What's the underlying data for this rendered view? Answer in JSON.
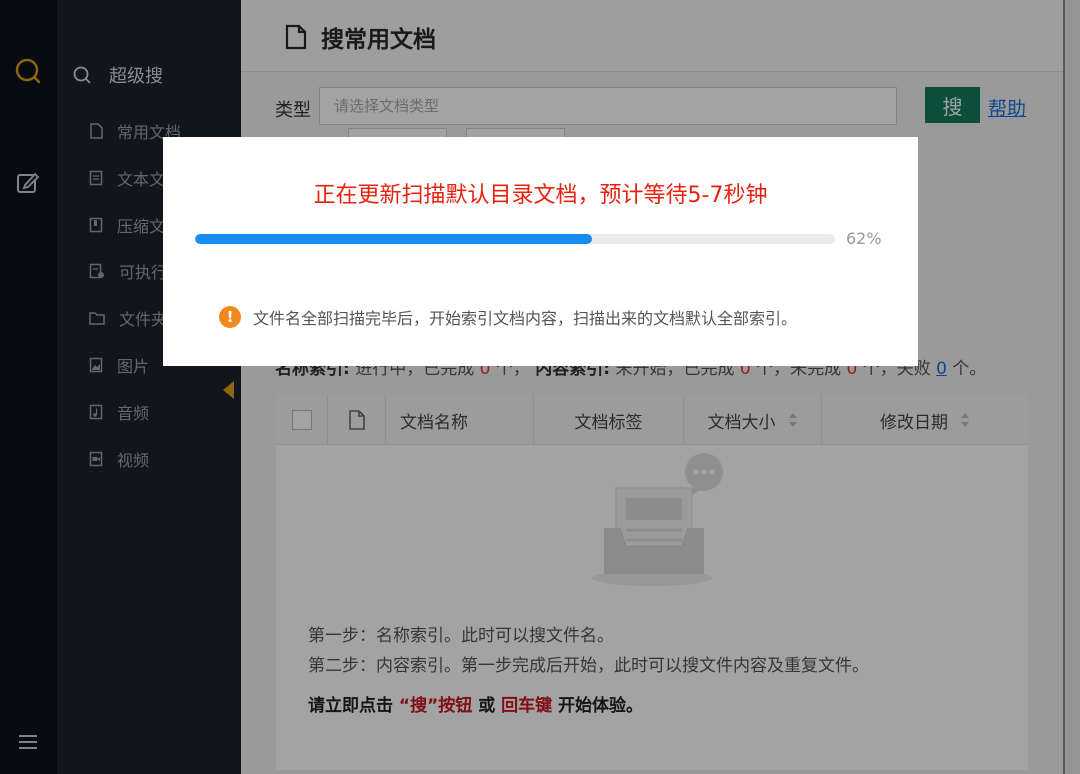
{
  "sidebar": {
    "title": "超级搜",
    "items": [
      {
        "label": "常用文档",
        "icon": "file-icon"
      },
      {
        "label": "文本文档",
        "icon": "text-file-icon"
      },
      {
        "label": "压缩文件",
        "icon": "archive-icon"
      },
      {
        "label": "可执行文件",
        "icon": "executable-icon"
      },
      {
        "label": "文件夹",
        "icon": "folder-icon"
      },
      {
        "label": "图片",
        "icon": "image-icon"
      },
      {
        "label": "音频",
        "icon": "audio-icon"
      },
      {
        "label": "视频",
        "icon": "video-icon"
      }
    ]
  },
  "header": {
    "title": "搜常用文档"
  },
  "filter": {
    "type_label": "类型",
    "type_placeholder": "请选择文档类型",
    "search_button": "搜",
    "help_link": "帮助"
  },
  "status": {
    "name_index_label": "名称索引:",
    "name_index_state": "进行中，已完成",
    "name_index_done": "0",
    "name_index_unit": "个，",
    "content_index_label": "内容索引:",
    "content_index_state": "未开始，已完成",
    "content_done": "0",
    "content_unit": "个，未完成",
    "content_pending": "0",
    "failed_text": "个，失败",
    "failed_count": "0",
    "failed_unit": "个。"
  },
  "table": {
    "columns": [
      "文档名称",
      "文档标签",
      "文档大小",
      "修改日期"
    ],
    "empty_steps": [
      "第一步：名称索引。此时可以搜文件名。",
      "第二步：内容索引。第一步完成后开始，此时可以搜文件内容及重复文件。"
    ],
    "cta_prefix": "请立即点击",
    "cta_button": "“搜”按钮",
    "cta_or": "或",
    "cta_key": "回车键",
    "cta_suffix": "开始体验。"
  },
  "modal": {
    "title": "正在更新扫描默认目录文档，预计等待5-7秒钟",
    "progress": 62,
    "progress_label": "62%",
    "note": "文件名全部扫描完毕后，开始索引文档内容，扫描出来的文档默认全部索引。"
  },
  "colors": {
    "accent_green": "#127a5d",
    "link_blue": "#1a73d9",
    "progress_blue": "#1a8cf0",
    "warning_orange": "#f08a1c",
    "title_red": "#e8220f",
    "rail_icon_orange": "#e0a11b"
  }
}
